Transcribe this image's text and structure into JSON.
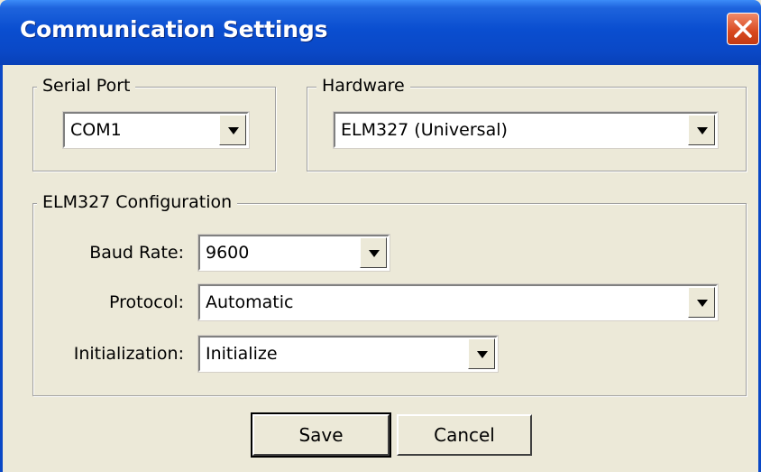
{
  "window": {
    "title": "Communication Settings"
  },
  "serial_port": {
    "group_label": "Serial Port",
    "value": "COM1"
  },
  "hardware": {
    "group_label": "Hardware",
    "value": "ELM327 (Universal)"
  },
  "elm_config": {
    "group_label": "ELM327 Configuration",
    "baud_rate": {
      "label": "Baud Rate:",
      "value": "9600"
    },
    "protocol": {
      "label": "Protocol:",
      "value": "Automatic"
    },
    "initialization": {
      "label": "Initialization:",
      "value": "Initialize"
    }
  },
  "buttons": {
    "save": "Save",
    "cancel": "Cancel"
  },
  "colors": {
    "titlebar": "#0a48c6",
    "dialog_bg": "#ece9d8",
    "close_button": "#d8481e"
  },
  "icons": {
    "close": "close-icon",
    "dropdown": "chevron-down-icon"
  }
}
